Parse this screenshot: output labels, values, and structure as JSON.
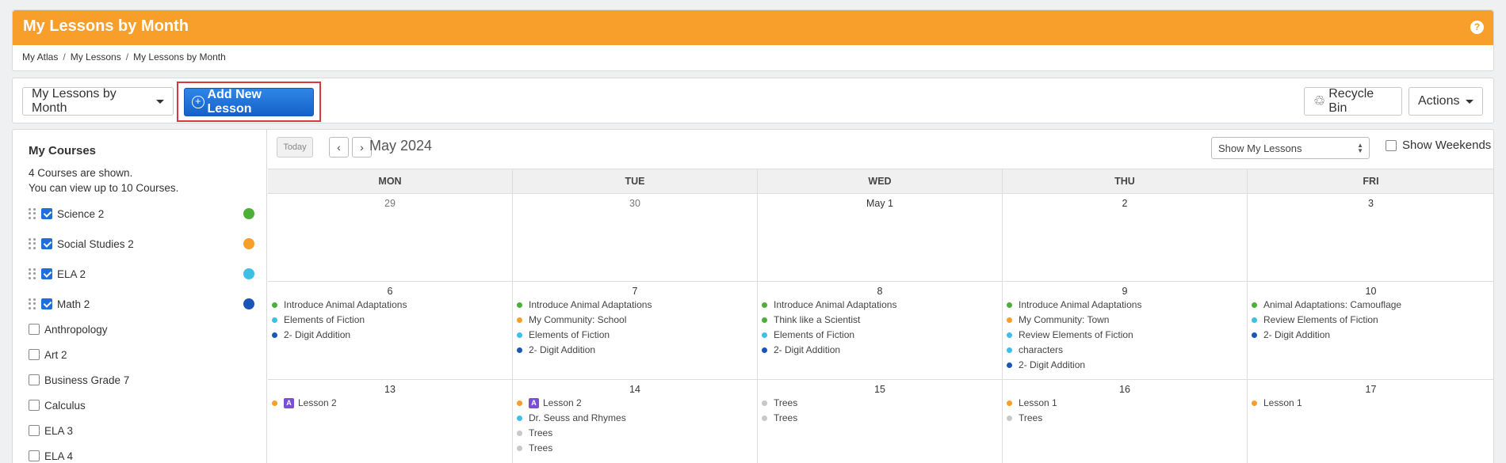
{
  "header": {
    "title": "My Lessons by Month",
    "help": "?"
  },
  "breadcrumb": [
    "My Atlas",
    "My Lessons",
    "My Lessons by Month"
  ],
  "breadcrumb_sep": "/",
  "toolbar": {
    "view_label": "My Lessons by Month",
    "add_label": "Add New Lesson",
    "add_icon": "+",
    "recycle_label": "Recycle Bin",
    "recycle_icon": "♲",
    "actions_label": "Actions"
  },
  "sidebar": {
    "title": "My Courses",
    "note1": "4 Courses are shown.",
    "note2": "You can view up to 10 Courses.",
    "courses": [
      {
        "label": "Science 2",
        "checked": true,
        "color": "#4caf37"
      },
      {
        "label": "Social Studies 2",
        "checked": true,
        "color": "#f89f2b"
      },
      {
        "label": "ELA 2",
        "checked": true,
        "color": "#3dbfe6"
      },
      {
        "label": "Math 2",
        "checked": true,
        "color": "#1a55b8"
      },
      {
        "label": "Anthropology",
        "checked": false
      },
      {
        "label": "Art 2",
        "checked": false
      },
      {
        "label": "Business Grade 7",
        "checked": false
      },
      {
        "label": "Calculus",
        "checked": false
      },
      {
        "label": "ELA 3",
        "checked": false
      },
      {
        "label": "ELA 4",
        "checked": false
      }
    ]
  },
  "calendar": {
    "today_label": "Today",
    "prev_icon": "‹",
    "next_icon": "›",
    "month_label": "May 2024",
    "select_value": "Show My Lessons",
    "weekends_label": "Show Weekends",
    "days": [
      "MON",
      "TUE",
      "WED",
      "THU",
      "FRI"
    ],
    "weeks": [
      [
        {
          "date": "29",
          "muted": true,
          "events": []
        },
        {
          "date": "30",
          "muted": true,
          "events": []
        },
        {
          "date": "May  1",
          "events": []
        },
        {
          "date": "2",
          "events": []
        },
        {
          "date": "3",
          "events": []
        }
      ],
      [
        {
          "date": "6",
          "events": [
            {
              "t": "Introduce Animal Adaptations",
              "c": "#4caf37"
            },
            {
              "t": "Elements of Fiction",
              "c": "#3dbfe6"
            },
            {
              "t": "2- Digit Addition",
              "c": "#1a55b8"
            }
          ]
        },
        {
          "date": "7",
          "events": [
            {
              "t": "Introduce Animal Adaptations",
              "c": "#4caf37"
            },
            {
              "t": "My Community: School",
              "c": "#f89f2b"
            },
            {
              "t": "Elements of Fiction",
              "c": "#3dbfe6"
            },
            {
              "t": "2- Digit Addition",
              "c": "#1a55b8"
            }
          ]
        },
        {
          "date": "8",
          "events": [
            {
              "t": "Introduce Animal Adaptations",
              "c": "#4caf37"
            },
            {
              "t": "Think like a Scientist",
              "c": "#4caf37"
            },
            {
              "t": "Elements of Fiction",
              "c": "#3dbfe6"
            },
            {
              "t": "2- Digit Addition",
              "c": "#1a55b8"
            }
          ]
        },
        {
          "date": "9",
          "events": [
            {
              "t": "Introduce Animal Adaptations",
              "c": "#4caf37"
            },
            {
              "t": "My Community: Town",
              "c": "#f89f2b"
            },
            {
              "t": "Review Elements of Fiction",
              "c": "#3dbfe6"
            },
            {
              "t": "characters",
              "c": "#3dbfe6"
            },
            {
              "t": "2- Digit Addition",
              "c": "#1a55b8"
            }
          ]
        },
        {
          "date": "10",
          "events": [
            {
              "t": "Animal Adaptations: Camouflage",
              "c": "#4caf37"
            },
            {
              "t": "Review Elements of Fiction",
              "c": "#3dbfe6"
            },
            {
              "t": "2- Digit Addition",
              "c": "#1a55b8"
            }
          ]
        }
      ],
      [
        {
          "date": "13",
          "events": [
            {
              "t": "Lesson 2",
              "c": "#f89f2b",
              "badge": "A"
            }
          ]
        },
        {
          "date": "14",
          "events": [
            {
              "t": "Lesson 2",
              "c": "#f89f2b",
              "badge": "A"
            },
            {
              "t": "Dr. Seuss and Rhymes",
              "c": "#3dbfe6"
            },
            {
              "t": "Trees",
              "c": "#c8c8c8"
            },
            {
              "t": "Trees",
              "c": "#c8c8c8"
            }
          ]
        },
        {
          "date": "15",
          "events": [
            {
              "t": "Trees",
              "c": "#c8c8c8"
            },
            {
              "t": "Trees",
              "c": "#c8c8c8"
            }
          ]
        },
        {
          "date": "16",
          "events": [
            {
              "t": "Lesson 1",
              "c": "#f89f2b"
            },
            {
              "t": "Trees",
              "c": "#c8c8c8"
            }
          ]
        },
        {
          "date": "17",
          "events": [
            {
              "t": "Lesson 1",
              "c": "#f89f2b"
            }
          ]
        }
      ]
    ]
  }
}
